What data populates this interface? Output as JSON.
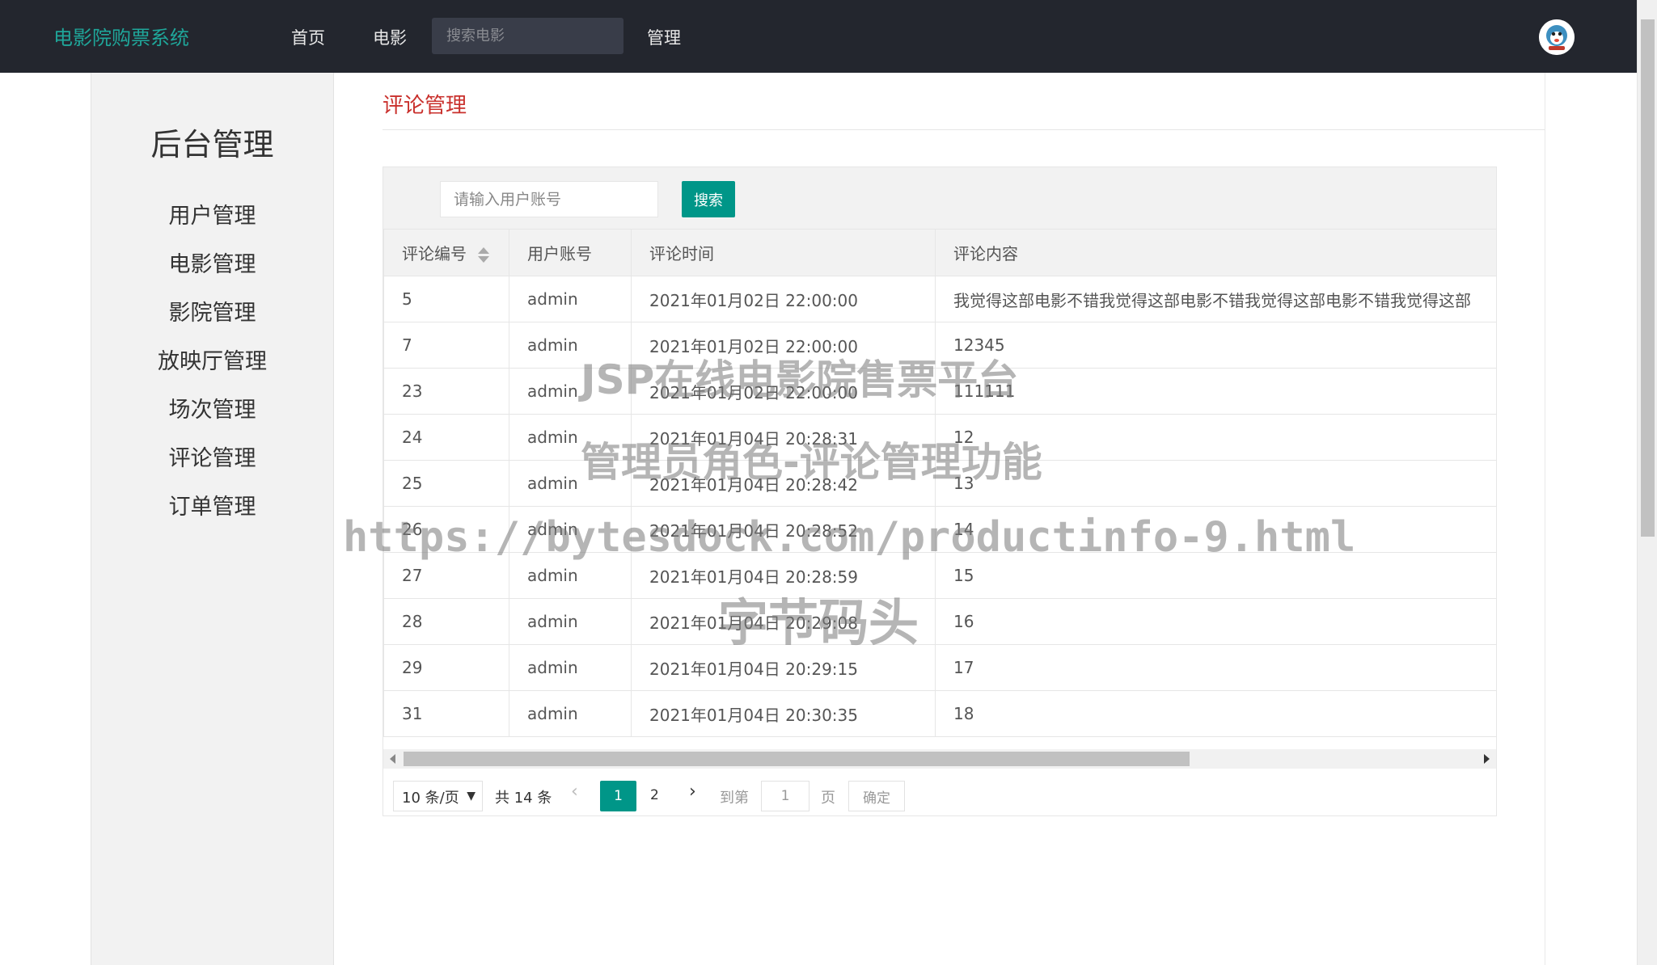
{
  "navbar": {
    "brand": "电影院购票系统",
    "items": [
      "首页",
      "电影",
      "管理"
    ],
    "search_placeholder": "搜索电影",
    "avatar_icon": "user-avatar-icon"
  },
  "sidebar": {
    "title": "后台管理",
    "items": [
      "用户管理",
      "电影管理",
      "影院管理",
      "放映厅管理",
      "场次管理",
      "评论管理",
      "订单管理"
    ]
  },
  "main": {
    "title": "评论管理",
    "search": {
      "placeholder": "请输入用户账号",
      "button": "搜索"
    },
    "table": {
      "columns": [
        "评论编号",
        "用户账号",
        "评论时间",
        "评论内容"
      ],
      "rows": [
        [
          "5",
          "admin",
          "2021年01月02日 22:00:00",
          "我觉得这部电影不错我觉得这部电影不错我觉得这部电影不错我觉得这部"
        ],
        [
          "7",
          "admin",
          "2021年01月02日 22:00:00",
          "12345"
        ],
        [
          "23",
          "admin",
          "2021年01月02日 22:00:00",
          "111111"
        ],
        [
          "24",
          "admin",
          "2021年01月04日 20:28:31",
          "12"
        ],
        [
          "25",
          "admin",
          "2021年01月04日 20:28:42",
          "13"
        ],
        [
          "26",
          "admin",
          "2021年01月04日 20:28:52",
          "14"
        ],
        [
          "27",
          "admin",
          "2021年01月04日 20:28:59",
          "15"
        ],
        [
          "28",
          "admin",
          "2021年01月04日 20:29:08",
          "16"
        ],
        [
          "29",
          "admin",
          "2021年01月04日 20:29:15",
          "17"
        ],
        [
          "31",
          "admin",
          "2021年01月04日 20:30:35",
          "18"
        ]
      ]
    },
    "pager": {
      "limit": "10 条/页",
      "total": "共 14 条",
      "pages": [
        "1",
        "2"
      ],
      "current_page": "1",
      "goto_label": "到第",
      "goto_value": "1",
      "goto_unit": "页",
      "confirm": "确定"
    }
  },
  "watermark": {
    "line1": "JSP在线电影院售票平台",
    "line2": "管理员角色-评论管理功能",
    "line3": "https://bytesdock.com/productinfo-9.html",
    "line4": "字节码头"
  },
  "colors": {
    "navbar_bg": "#23262e",
    "brand": "#1fa69a",
    "accent": "#009688",
    "title_red": "#c9302c"
  }
}
